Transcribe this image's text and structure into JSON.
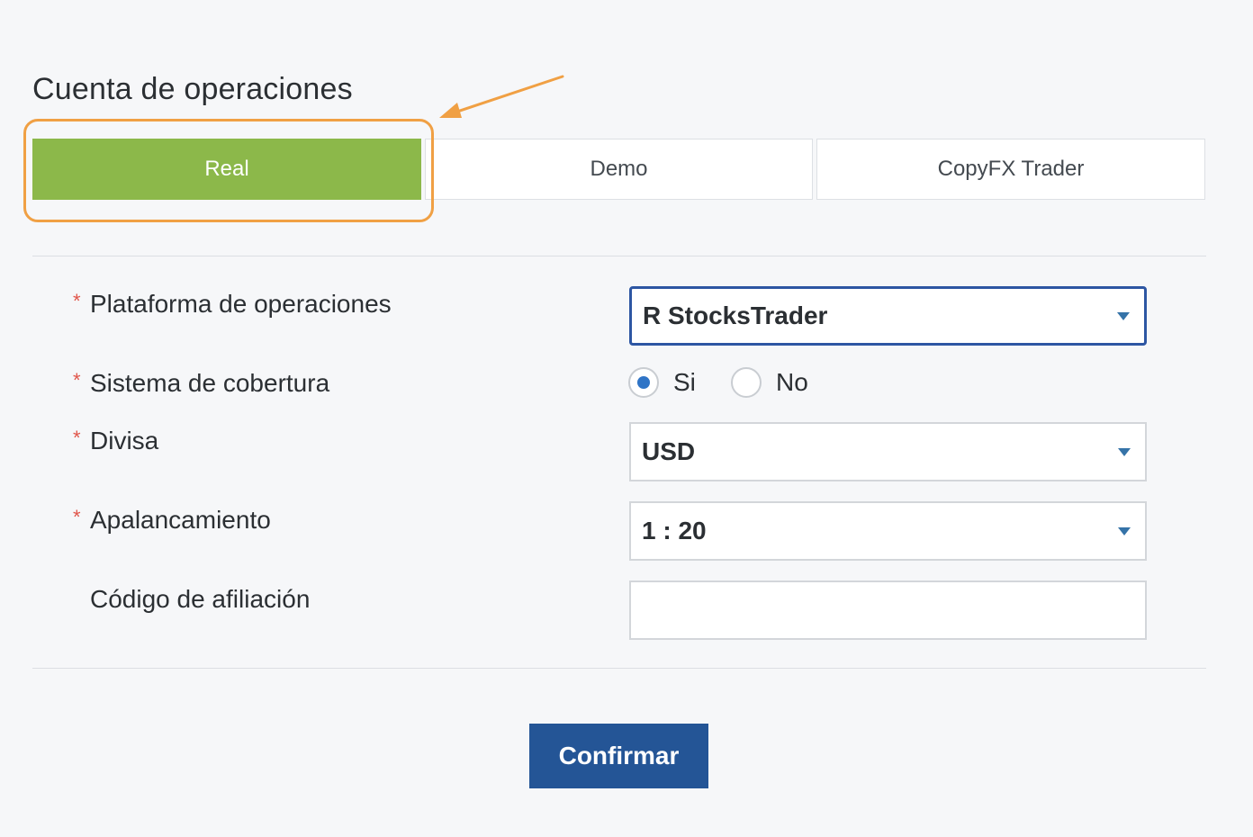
{
  "section": {
    "title": "Cuenta de operaciones"
  },
  "tabs": [
    {
      "label": "Real",
      "active": true
    },
    {
      "label": "Demo",
      "active": false
    },
    {
      "label": "CopyFX Trader",
      "active": false
    }
  ],
  "form": {
    "required_mark": "*",
    "platform": {
      "label": "Plataforma de operaciones",
      "value": "R StocksTrader"
    },
    "hedging": {
      "label": "Sistema de cobertura",
      "options": [
        {
          "label": "Si",
          "checked": true
        },
        {
          "label": "No",
          "checked": false
        }
      ]
    },
    "currency": {
      "label": "Divisa",
      "value": "USD"
    },
    "leverage": {
      "label": "Apalancamiento",
      "value": "1 : 20"
    },
    "affiliate": {
      "label": "Código de afiliación",
      "value": "",
      "placeholder": ""
    }
  },
  "actions": {
    "confirm_label": "Confirmar"
  },
  "colors": {
    "active_tab": "#8cb84a",
    "highlight": "#f0a044",
    "primary_button": "#245596",
    "focus_border": "#2d56a3",
    "required": "#e0554a"
  }
}
